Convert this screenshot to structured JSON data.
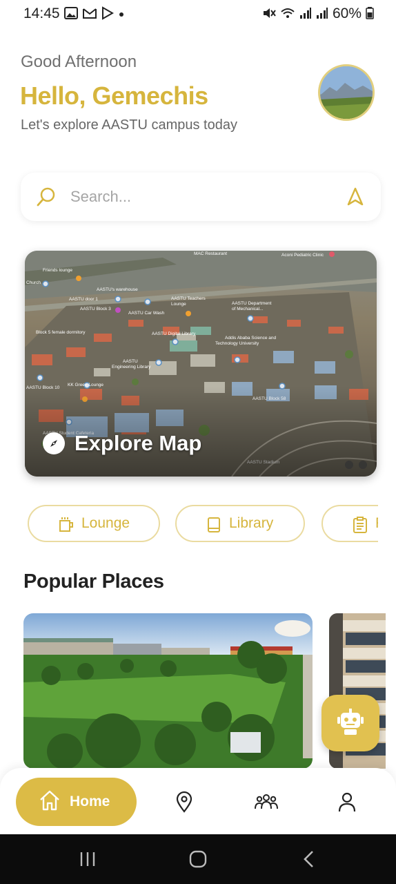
{
  "status_bar": {
    "time": "14:45",
    "battery": "60%",
    "icons": [
      "gallery-icon",
      "gmail-icon",
      "play-store-icon",
      "dot-icon",
      "mute-icon",
      "wifi-icon",
      "signal-icon",
      "signal-icon",
      "battery-icon"
    ]
  },
  "greeting": {
    "subtitle": "Good Afternoon",
    "title": "Hello, Gemechis",
    "description": "Let's explore AASTU campus today"
  },
  "search": {
    "placeholder": "Search..."
  },
  "map_card": {
    "label": "Explore Map",
    "place_labels": [
      "MAC Restaurant",
      "Aconi Pediatric Clinic",
      "Friends lounge",
      "Church",
      "AASTU's warehouse",
      "AASTU door 1",
      "AASTU Teachers Lounge",
      "AASTU Department of Mechanical...",
      "AASTU Block 3",
      "AASTU Car Wash",
      "Block 5 female dormitory",
      "AASTU Digital Library",
      "Addis Ababa Science and Technology University",
      "AASTU Engineering Library",
      "KK Green Lounge",
      "AASTU Block 10",
      "AASTU Block 58",
      "AASTU Student Cafeteria",
      "AASTU Stadium"
    ]
  },
  "chips": [
    {
      "label": "Lounge",
      "icon": "cup-icon"
    },
    {
      "label": "Library",
      "icon": "book-icon"
    },
    {
      "label": "R",
      "icon": "clipboard-icon"
    }
  ],
  "popular": {
    "title": "Popular Places"
  },
  "bottom_nav": {
    "home_label": "Home",
    "items": [
      "home-icon",
      "location-pin-icon",
      "community-icon",
      "profile-icon"
    ]
  },
  "colors": {
    "accent": "#d6b53d",
    "accent_fill": "#dcbb46",
    "chip_border": "#eadba0",
    "text_gray": "#6f6f6f"
  }
}
